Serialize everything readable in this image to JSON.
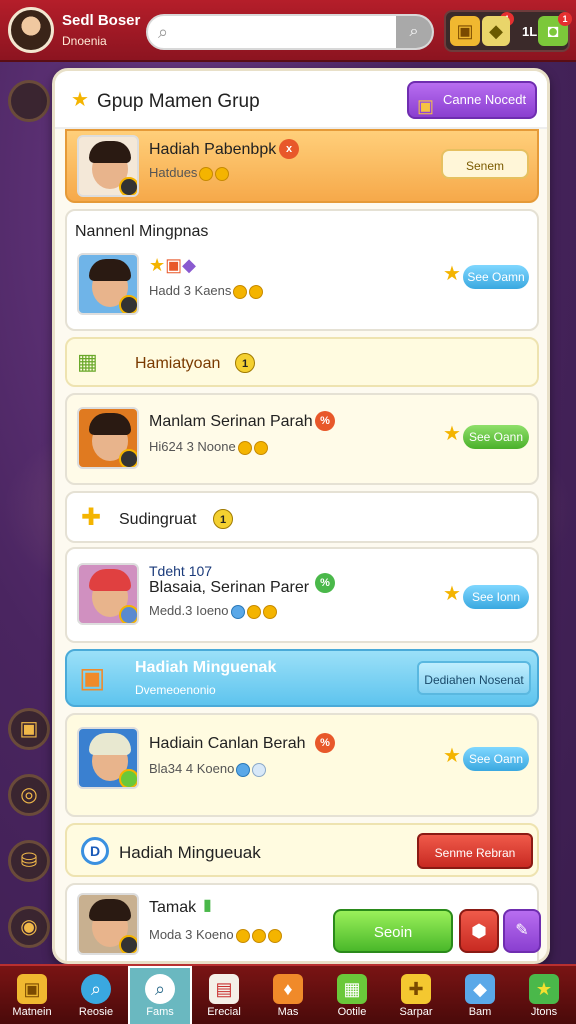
{
  "header": {
    "user_name": "Sedl Boser",
    "user_sub": "Dnoenia",
    "search_placeholder": "",
    "currency_value": "1L",
    "currency_badges": [
      "1",
      "1"
    ]
  },
  "panel": {
    "title": "Gpup Mamen Grup",
    "header_button": "Canne Nocedt"
  },
  "rows": [
    {
      "name": "Hadiah Pabenbpk",
      "sub": "Hatdues",
      "button": "Senem",
      "tag": "x"
    },
    {
      "title": "Nannenl Mingpnas",
      "sub": "Hadd 3 Kaens",
      "button": "See Oamn"
    },
    {
      "section": "Hamiatyoan",
      "section_num": "1"
    },
    {
      "name": "Manlam Serinan Parah",
      "sub": "Hi624 3 Noone",
      "button": "See Oann",
      "tag": "%"
    },
    {
      "section": "Sudingruat",
      "section_num": "1"
    },
    {
      "name": "Tdeht 107",
      "name2": "Blasaia, Serinan Parer",
      "sub": "Medd.3 Ioeno",
      "button": "See Ionn",
      "tag": "%"
    },
    {
      "section": "Hadiah Minguenak",
      "sub": "Dvemeoenonio",
      "button": "Dediahen Nosenat"
    },
    {
      "name": "Hadiain Canlan Berah",
      "sub": "Bla34 4 Koeno",
      "button": "See Oann",
      "tag": "%"
    },
    {
      "section": "Hadiah Mingueuak",
      "section_badge": "D",
      "button": "Senme Rebran"
    },
    {
      "name": "Tamak",
      "sub": "Moda 3 Koeno",
      "button": "Seoin"
    }
  ],
  "nav": [
    {
      "label": "Matnein"
    },
    {
      "label": "Reosie"
    },
    {
      "label": "Fams"
    },
    {
      "label": "Erecial"
    },
    {
      "label": "Mas"
    },
    {
      "label": "Ootile"
    },
    {
      "label": "Sarpar"
    },
    {
      "label": "Bam"
    },
    {
      "label": "Jtons"
    }
  ]
}
